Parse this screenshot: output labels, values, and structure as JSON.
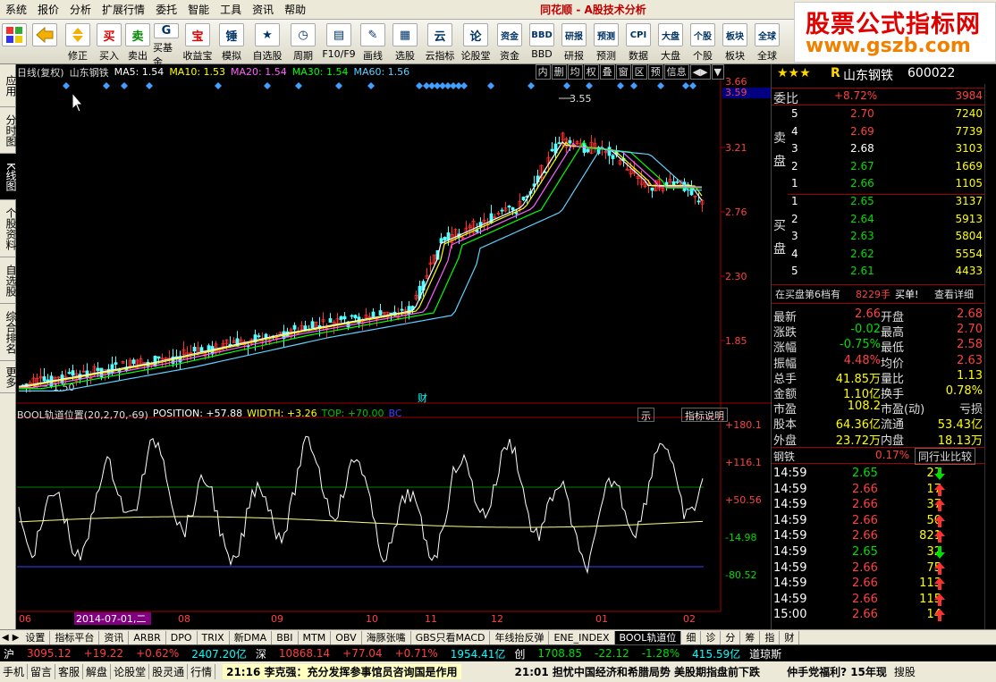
{
  "menu": [
    "系统",
    "报价",
    "分析",
    "扩展行情",
    "委托",
    "智能",
    "工具",
    "资讯",
    "帮助"
  ],
  "window_title": "同花顺 - A股技术分析",
  "brand": {
    "line1": "股票公式指标网",
    "line2": "www.gszb.com"
  },
  "toolbar": [
    {
      "label": "",
      "icon": "windows-icon"
    },
    {
      "label": "",
      "icon": "back-arrow-icon"
    },
    {
      "label": "修正",
      "icon": "arrows-icon"
    },
    {
      "label": "买入",
      "glyph": "买"
    },
    {
      "label": "卖出",
      "glyph": "卖"
    },
    {
      "label": "买基金",
      "glyph": "G"
    },
    {
      "label": "收益宝",
      "glyph": "宝"
    },
    {
      "label": "模拟",
      "glyph": "锤"
    },
    {
      "label": "自选股",
      "glyph": "★"
    },
    {
      "label": "周期",
      "glyph": "◷"
    },
    {
      "label": "F10/F9",
      "glyph": "▤"
    },
    {
      "label": "画线",
      "glyph": "✎"
    },
    {
      "label": "选股",
      "glyph": "▦"
    },
    {
      "label": "云指标",
      "glyph": "云"
    },
    {
      "label": "论股堂",
      "glyph": "论"
    },
    {
      "label": "资金",
      "glyph": "资金"
    },
    {
      "label": "BBD",
      "glyph": "BBD"
    },
    {
      "label": "研报",
      "glyph": "研报"
    },
    {
      "label": "预测",
      "glyph": "预测"
    },
    {
      "label": "数据",
      "glyph": "CPI"
    },
    {
      "label": "大盘",
      "glyph": "大盘"
    },
    {
      "label": "个股",
      "glyph": "个股"
    },
    {
      "label": "板块",
      "glyph": "板块"
    },
    {
      "label": "全球",
      "glyph": "全球"
    }
  ],
  "left_tabs": [
    "应用",
    "分时图",
    "K线图",
    "个股资料",
    "自选股",
    "综合排名",
    "更多"
  ],
  "infobar": {
    "prefix": "日线(复权)",
    "stock": "山东钢铁",
    "ma5": "MA5: 1.54",
    "ma10": "MA10: 1.53",
    "ma20": "MA20: 1.54",
    "ma30": "MA30: 1.54",
    "ma60": "MA60: 1.56"
  },
  "chart_buttons": [
    "内",
    "删",
    "均",
    "权",
    "叠",
    "窗",
    "区",
    "预",
    "信息",
    "◀▶",
    "▼"
  ],
  "price_axis": [
    "3.66",
    "3.59",
    "3.21",
    "2.76",
    "2.30",
    "1.85"
  ],
  "high_label": "3.55",
  "low_label": "1.50",
  "cai_label": "财",
  "indicator_bar": {
    "name": "BOOL轨道位置(20,2,70,-69)",
    "position": "POSITION: +57.88",
    "width": "WIDTH: +3.26",
    "top": "TOP: +70.00",
    "bc": "BC",
    "btn1": "示",
    "btn2": "指标说明"
  },
  "ind_axis": [
    "+180.1",
    "+116.1",
    "+50.56",
    "-14.98",
    "-80.52"
  ],
  "x_axis": [
    "06",
    "2014-07-01,二",
    "08",
    "09",
    "10",
    "11",
    "12",
    "01",
    "02"
  ],
  "stock_header": {
    "stars": "★★★",
    "r": "R",
    "name": "山东钢铁",
    "code": "600022"
  },
  "weibi": {
    "label": "委比",
    "pct": "+8.72%",
    "val": "3984"
  },
  "sell": [
    {
      "n": "5",
      "p": "2.70",
      "v": "7240"
    },
    {
      "n": "4",
      "p": "2.69",
      "v": "7739"
    },
    {
      "n": "3",
      "p": "2.68",
      "v": "3103"
    },
    {
      "n": "2",
      "p": "2.67",
      "v": "1669"
    },
    {
      "n": "1",
      "p": "2.66",
      "v": "1105"
    }
  ],
  "buy": [
    {
      "n": "1",
      "p": "2.65",
      "v": "3137"
    },
    {
      "n": "2",
      "p": "2.64",
      "v": "5913"
    },
    {
      "n": "3",
      "p": "2.63",
      "v": "5804"
    },
    {
      "n": "4",
      "p": "2.62",
      "v": "5554"
    },
    {
      "n": "5",
      "p": "2.61",
      "v": "4433"
    }
  ],
  "sell_label": [
    "卖",
    "盘"
  ],
  "buy_label": [
    "买",
    "盘"
  ],
  "queue": {
    "text": "在买盘第6档有",
    "hands": "8229手",
    "buy": "买单!",
    "detail": "查看详细"
  },
  "quote": [
    {
      "l1": "最新",
      "v1": "2.66",
      "l2": "开盘",
      "v2": "2.68"
    },
    {
      "l1": "涨跌",
      "v1": "-0.02",
      "l2": "最高",
      "v2": "2.70"
    },
    {
      "l1": "涨幅",
      "v1": "-0.75%",
      "l2": "最低",
      "v2": "2.58"
    },
    {
      "l1": "振幅",
      "v1": "4.48%",
      "l2": "均价",
      "v2": "2.63"
    },
    {
      "l1": "总手",
      "v1": "41.85万",
      "l2": "量比",
      "v2": "1.13"
    },
    {
      "l1": "金额",
      "v1": "1.10亿",
      "l2": "换手",
      "v2": "0.78%"
    },
    {
      "l1": "市盈",
      "v1": "108.2",
      "l2": "市盈(动)",
      "v2": "亏损"
    },
    {
      "l1": "股本",
      "v1": "64.36亿",
      "l2": "流通",
      "v2": "53.43亿"
    },
    {
      "l1": "外盘",
      "v1": "23.72万",
      "l2": "内盘",
      "v2": "18.13万"
    }
  ],
  "industry": {
    "name": "钢铁",
    "pct": "0.17%",
    "btn": "同行业比较"
  },
  "ticks": [
    {
      "t": "14:59",
      "p": "2.65",
      "v": "27",
      "d": "down"
    },
    {
      "t": "14:59",
      "p": "2.66",
      "v": "17",
      "d": "up"
    },
    {
      "t": "14:59",
      "p": "2.66",
      "v": "37",
      "d": "up"
    },
    {
      "t": "14:59",
      "p": "2.66",
      "v": "50",
      "d": "up"
    },
    {
      "t": "14:59",
      "p": "2.66",
      "v": "821",
      "d": "up"
    },
    {
      "t": "14:59",
      "p": "2.65",
      "v": "32",
      "d": "down"
    },
    {
      "t": "14:59",
      "p": "2.66",
      "v": "75",
      "d": "up"
    },
    {
      "t": "14:59",
      "p": "2.66",
      "v": "113",
      "d": "up"
    },
    {
      "t": "14:59",
      "p": "2.66",
      "v": "115",
      "d": "up"
    },
    {
      "t": "15:00",
      "p": "2.66",
      "v": "14",
      "d": "up"
    }
  ],
  "bottom_tabs": [
    "设置",
    "指标平台",
    "资讯",
    "ARBR",
    "DPO",
    "TRIX",
    "新DMA",
    "BBI",
    "MTM",
    "OBV",
    "海豚张嘴",
    "GBS只看MACD",
    "年线抬反弹",
    "ENE_INDEX",
    "BOOL轨道位",
    "细",
    "诊",
    "分",
    "筹",
    "指",
    "财"
  ],
  "status1": [
    {
      "t": "沪",
      "c": "white"
    },
    {
      "t": "3095.12",
      "c": "red"
    },
    {
      "t": "+19.22",
      "c": "red"
    },
    {
      "t": "+0.62%",
      "c": "red"
    },
    {
      "t": "2407.20亿",
      "c": "cyan"
    },
    {
      "t": "深",
      "c": "white"
    },
    {
      "t": "10868.14",
      "c": "red"
    },
    {
      "t": "+77.04",
      "c": "red"
    },
    {
      "t": "+0.71%",
      "c": "red"
    },
    {
      "t": "1954.41亿",
      "c": "cyan"
    },
    {
      "t": "创",
      "c": "white"
    },
    {
      "t": "1708.85",
      "c": "green"
    },
    {
      "t": "-22.12",
      "c": "green"
    },
    {
      "t": "-1.28%",
      "c": "green"
    },
    {
      "t": "415.59亿",
      "c": "cyan"
    },
    {
      "t": "道琼斯",
      "c": "white"
    }
  ],
  "status2": {
    "items": [
      "手机",
      "留言",
      "客服",
      "解盘",
      "论股堂",
      "股灵通",
      "行情"
    ],
    "news1": "21:16 李克强：充分发挥参事馆员咨询国是作用",
    "news2": "21:01 担忧中国经济和希腊局势 美股期指盘前下跌",
    "promo": "仲手党福利? 15年现",
    "search": "搜股"
  }
}
